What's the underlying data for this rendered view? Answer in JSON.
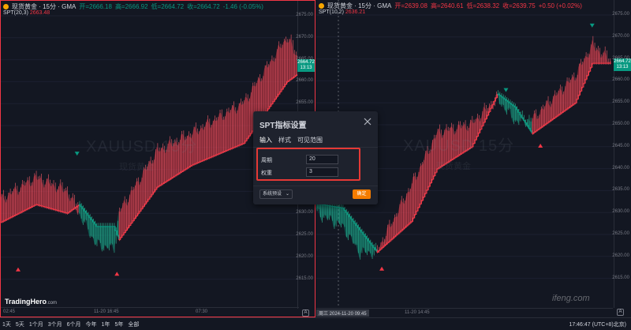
{
  "left": {
    "title": "现货黄金 · 15分 · GMA",
    "ohlc": [
      "开=2666.18",
      "高=2666.92",
      "低=2664.72",
      "收=2664.72",
      "-1.46 (-0.05%)"
    ],
    "indicator_name": "SPT(20,3)",
    "indicator_value": "2663.48",
    "price_ticks": [
      "2675.00",
      "2670.00",
      "2665.00",
      "2660.00",
      "2655.00",
      "2650.00",
      "2645.00",
      "2640.00",
      "2635.00",
      "2630.00",
      "2625.00",
      "2620.00",
      "2615.00"
    ],
    "price_tag": "2664.72",
    "price_tag_time": "13:13",
    "time_labels": [
      "02:45",
      "11-20 16:45",
      "07:30"
    ],
    "watermark": "XAUUSD 15分",
    "watermark_sub": "现货黄金",
    "brand": "TradingHero",
    "brand_suffix": ".com",
    "auto_label": "A"
  },
  "right": {
    "title": "现货黄金 · 15分 · GMA",
    "ohlc": [
      "开=2639.08",
      "高=2640.61",
      "低=2638.32",
      "收=2639.75",
      "+0.50 (+0.02%)"
    ],
    "indicator_name": "SPT(10,2)",
    "indicator_value": "2636.21",
    "price_ticks": [
      "2675.00",
      "2670.00",
      "2665.00",
      "2660.00",
      "2655.00",
      "2650.00",
      "2645.00",
      "2640.00",
      "2635.00",
      "2630.00",
      "2625.00",
      "2620.00",
      "2615.00"
    ],
    "price_tag": "2664.72",
    "price_tag_time": "13:13",
    "crosshair_time": "周三 2024-11-20 09:45",
    "time_labels": [
      "11-20 14:45"
    ],
    "watermark": "XAUUSD 15分",
    "watermark_sub": "现货黄金",
    "auto_label": "A"
  },
  "dialog": {
    "title": "SPT指标设置",
    "tabs": [
      "输入",
      "样式",
      "可见范围"
    ],
    "fields": [
      {
        "label": "周期",
        "value": "20"
      },
      {
        "label": "权重",
        "value": "3"
      }
    ],
    "preset_label": "系统预设",
    "ok_label": "确定"
  },
  "bottom_bar": {
    "timeframes": [
      "1天",
      "5天",
      "1个月",
      "3个月",
      "6个月",
      "今年",
      "1年",
      "5年",
      "全部"
    ],
    "clock": "17:46:47 (UTC+8)北京)"
  },
  "overlay_watermark": "ifeng.com",
  "colors": {
    "up": "#089981",
    "down": "#f23645",
    "fill_down": "rgba(242,54,69,0.45)",
    "fill_up": "rgba(8,153,129,0.45)",
    "accent": "#f57c00"
  }
}
